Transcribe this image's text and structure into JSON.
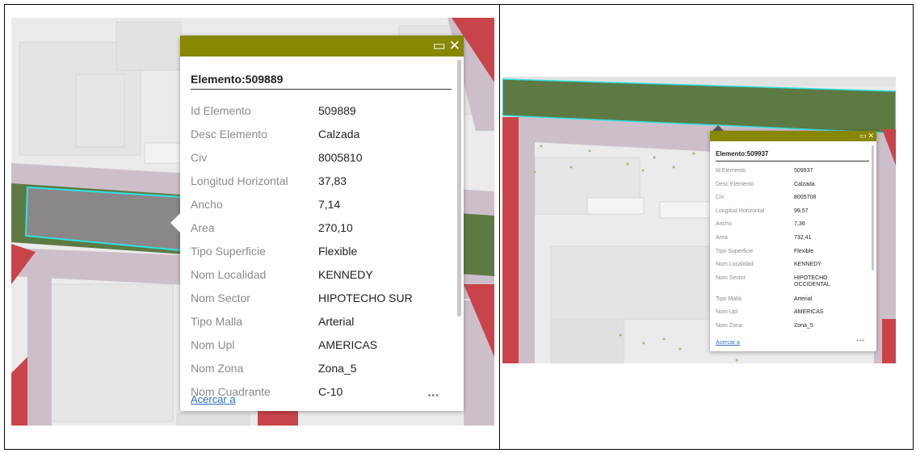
{
  "left_popup": {
    "title": "Elemento:509889",
    "fields": [
      {
        "label": "Id Elemento",
        "value": "509889"
      },
      {
        "label": "Desc Elemento",
        "value": "Calzada"
      },
      {
        "label": "Civ",
        "value": "8005810"
      },
      {
        "label": "Longitud Horizontal",
        "value": "37,83"
      },
      {
        "label": "Ancho",
        "value": "7,14"
      },
      {
        "label": "Area",
        "value": "270,10"
      },
      {
        "label": "Tipo Superficie",
        "value": "Flexible"
      },
      {
        "label": "Nom Localidad",
        "value": "KENNEDY"
      },
      {
        "label": "Nom Sector",
        "value": "HIPOTECHO SUR"
      },
      {
        "label": "Tipo Malla",
        "value": "Arterial"
      },
      {
        "label": "Nom Upl",
        "value": "AMERICAS"
      },
      {
        "label": "Nom Zona",
        "value": "Zona_5"
      },
      {
        "label": "Nom Cuadrante",
        "value": "C-10"
      }
    ],
    "zoom_link": "Acercar a",
    "more": "•••",
    "maximize_icon": "▭",
    "close_icon": "✕"
  },
  "right_popup": {
    "title": "Elemento:509937",
    "fields": [
      {
        "label": "Id Elemento",
        "value": "509937"
      },
      {
        "label": "Desc Elemento",
        "value": "Calzada"
      },
      {
        "label": "Civ",
        "value": "8005708"
      },
      {
        "label": "Longitud Horizontal",
        "value": "99,57"
      },
      {
        "label": "Ancho",
        "value": "7,36"
      },
      {
        "label": "Area",
        "value": "732,41"
      },
      {
        "label": "Tipo Superficie",
        "value": "Flexible"
      },
      {
        "label": "Nom Localidad",
        "value": "KENNEDY"
      },
      {
        "label": "Nom Sector",
        "value": "HIPOTECHO OCCIDENTAL"
      },
      {
        "label": "Tipo Malla",
        "value": "Arterial"
      },
      {
        "label": "Nom Upl",
        "value": "AMERICAS"
      },
      {
        "label": "Nom Zona",
        "value": "Zona_5"
      }
    ],
    "zoom_link": "Acercar a",
    "more": "•••",
    "maximize_icon": "▭",
    "close_icon": "✕"
  },
  "colors": {
    "header": "#878700",
    "selection": "#33e0e0",
    "road_green": "#5d7a45",
    "road_red": "#c9444a",
    "sidewalk": "#cdbfca",
    "map_bg": "#ebebeb"
  }
}
